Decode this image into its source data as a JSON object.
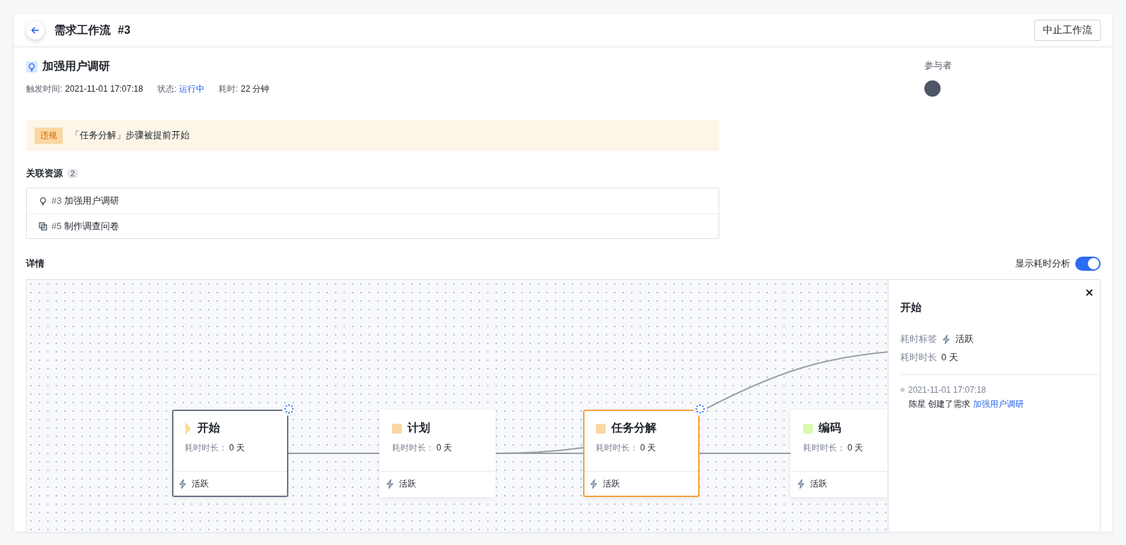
{
  "header": {
    "title": "需求工作流",
    "number": "#3",
    "action": "中止工作流"
  },
  "demand": {
    "title": "加强用户调研",
    "meta": [
      {
        "label": "触发时间:",
        "value": "2021-11-01 17:07:18",
        "kind": "plain"
      },
      {
        "label": "状态:",
        "value": "运行中",
        "kind": "status"
      },
      {
        "label": "耗时:",
        "value": "22 分钟",
        "kind": "plain"
      }
    ]
  },
  "participants": {
    "label": "参与者",
    "avatars": [
      {
        "kind": "user"
      }
    ]
  },
  "alert": {
    "tag": "违规",
    "message": "「任务分解」步骤被提前开始"
  },
  "resources": {
    "title": "关联资源",
    "count": "2",
    "items": [
      {
        "kind": "idea",
        "number": "#3",
        "name": "加强用户调研"
      },
      {
        "kind": "copy",
        "number": "#5",
        "name": "制作调查问卷"
      }
    ]
  },
  "details": {
    "title": "详情",
    "toggle": {
      "label": "显示耗时分析",
      "on": true
    }
  },
  "nodes": [
    {
      "kind": "start",
      "title": "开始",
      "color": "#fcd9a0",
      "duration_label": "耗时时长：",
      "duration": "0 天",
      "tag": "活跃",
      "selected": true,
      "warning": false,
      "spinner": true
    },
    {
      "kind": "step",
      "title": "计划",
      "color": "#fad7a2",
      "duration_label": "耗时时长：",
      "duration": "0 天",
      "tag": "活跃",
      "selected": false,
      "warning": false,
      "spinner": false
    },
    {
      "kind": "step",
      "title": "任务分解",
      "color": "#fad7a2",
      "duration_label": "耗时时长：",
      "duration": "0 天",
      "tag": "活跃",
      "selected": false,
      "warning": true,
      "spinner": true
    },
    {
      "kind": "step",
      "title": "编码",
      "color": "#d8fbb0",
      "duration_label": "耗时时长：",
      "duration": "0 天",
      "tag": "活跃",
      "selected": false,
      "warning": false,
      "spinner": false
    }
  ],
  "panel": {
    "title": "开始",
    "fields": [
      {
        "label": "耗时标签",
        "value": "活跃",
        "kind": "tag"
      },
      {
        "label": "耗时时长",
        "value": "0 天",
        "kind": "plain"
      }
    ],
    "log": [
      {
        "time": "2021-11-01 17:07:18",
        "text": "陈星 创建了需求",
        "link": "加强用户调研"
      }
    ]
  }
}
